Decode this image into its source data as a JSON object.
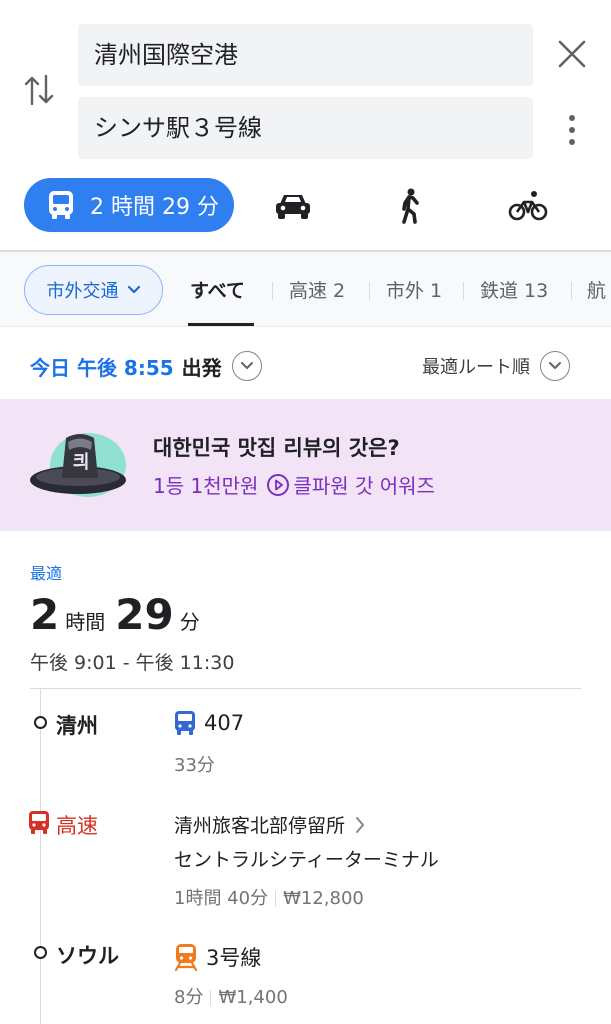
{
  "search": {
    "origin": "清州国際空港",
    "destination": "シンサ駅３号線"
  },
  "modes": {
    "transit_label": "2 時間 29 分",
    "icons": [
      "bus-icon",
      "car-icon",
      "walk-icon",
      "bike-icon"
    ],
    "accent_color": "#2f7ff0"
  },
  "filters": {
    "chip_label": "市外交通",
    "tabs": [
      "すべて",
      "高速 2",
      "市外 1",
      "鉄道 13",
      "航"
    ]
  },
  "depart": {
    "time": "今日 午後 8:55",
    "word": "出発",
    "sort_label": "最適ルート順"
  },
  "ad": {
    "title": "대한민국 맛집 리뷰의 갓은?",
    "sub_prefix": "1등 1천만원",
    "sub_suffix": "클파원 갓 어워즈",
    "background_color": "#f3e3f7",
    "art_label": "킈"
  },
  "route": {
    "badge": "最適",
    "hours": "2",
    "hours_unit": "時間",
    "minutes": "29",
    "minutes_unit": "分",
    "time_range": "午後 9:01 - 午後 11:30"
  },
  "legs": {
    "stop1": "清州",
    "bus_number": "407",
    "bus_duration": "33分",
    "stop2": "高速",
    "terminal_from": "清州旅客北部停留所",
    "terminal_to": "セントラルシティーターミナル",
    "express_duration": "1時間 40分",
    "express_fare": "₩12,800",
    "stop3": "ソウル",
    "line_name": "3号線",
    "subway_duration": "8分",
    "subway_fare": "₩1,400",
    "colors": {
      "city_bus": "#3367d6",
      "express_bus": "#d93025",
      "subway_line3": "#ef7c1c"
    }
  }
}
